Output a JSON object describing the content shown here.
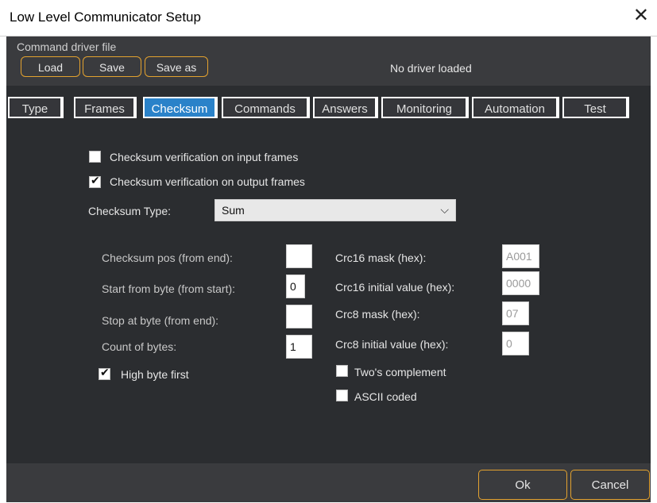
{
  "window": {
    "title": "Low Level Communicator Setup",
    "close_glyph": "✕"
  },
  "driver": {
    "section_label": "Command driver file",
    "load_label": "Load",
    "save_label": "Save",
    "save_as_label": "Save as",
    "status": "No driver loaded"
  },
  "tabs": [
    {
      "label": "Type"
    },
    {
      "label": "Frames"
    },
    {
      "label": "Checksum",
      "active": true
    },
    {
      "label": "Commands"
    },
    {
      "label": "Answers"
    },
    {
      "label": "Monitoring"
    },
    {
      "label": "Automation"
    },
    {
      "label": "Test"
    }
  ],
  "checksum": {
    "verify_input": {
      "label": "Checksum verification on input frames",
      "checked": false
    },
    "verify_output": {
      "label": "Checksum verification on output frames",
      "checked": true
    },
    "type_label": "Checksum Type:",
    "type_value": "Sum",
    "pos_label": "Checksum pos (from end):",
    "pos_value": "",
    "start_label": "Start from byte (from start):",
    "start_value": "0",
    "stop_label": "Stop at byte (from end):",
    "stop_value": "",
    "count_label": "Count of bytes:",
    "count_value": "1",
    "high_byte": {
      "label": "High byte first",
      "checked": true
    },
    "crc16_mask_label": "Crc16 mask (hex):",
    "crc16_mask_value": "A001",
    "crc16_init_label": "Crc16 initial value (hex):",
    "crc16_init_value": "0000",
    "crc8_mask_label": "Crc8 mask (hex):",
    "crc8_mask_value": "07",
    "crc8_init_label": "Crc8 initial value (hex):",
    "crc8_init_value": "0",
    "twos_complement": {
      "label": "Two's complement",
      "checked": false
    },
    "ascii_coded": {
      "label": "ASCII coded",
      "checked": false
    }
  },
  "footer": {
    "ok_label": "Ok",
    "cancel_label": "Cancel"
  },
  "colors": {
    "accent": "#e3a22f",
    "active_tab": "#2a82c9",
    "background": "#2b2d30"
  }
}
